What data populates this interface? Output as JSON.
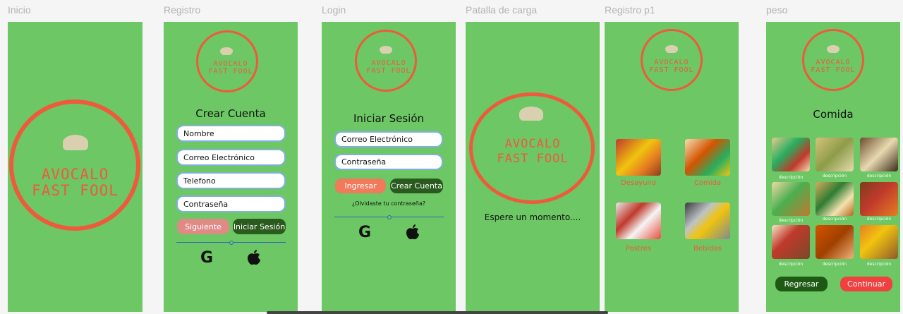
{
  "colors": {
    "frame_bg": "#6cc764",
    "logo": "#ef5a3c",
    "input_border": "#7fb0e0",
    "dark_button": "#2a5a1e",
    "salmon_button": "#e08a86",
    "orange_button": "#f07a5a",
    "red_button": "#f04040"
  },
  "frames": {
    "inicio": {
      "label": "Inicio",
      "logo_line1": "AVOCALO",
      "logo_line2": "FAST FOOL"
    },
    "registro": {
      "label": "Registro",
      "logo_line1": "AVOCALO",
      "logo_line2": "FAST FOOL",
      "title": "Crear Cuenta",
      "fields": [
        "Nombre",
        "Correo Electrónico",
        "Telefono",
        "Contraseña"
      ],
      "next_label": "Siguiente",
      "login_label": "Iniciar Sesión",
      "google_glyph": "G",
      "apple_glyph": ""
    },
    "login": {
      "label": "Login",
      "logo_line1": "AVOCALO",
      "logo_line2": "FAST FOOL",
      "title": "Iniciar Sesión",
      "fields": [
        "Correo Electrónico",
        "Contraseña"
      ],
      "enter_label": "Ingresar",
      "create_label": "Crear Cuenta",
      "forgot": "¿Olvidaste tu contraseña?",
      "google_glyph": "G"
    },
    "carga": {
      "label": "Patalla de carga",
      "logo_line1": "AVOCALO",
      "logo_line2": "FAST FOOL",
      "message": "Espere un momento...."
    },
    "registro_p1": {
      "label": "Registro p1",
      "logo_line1": "AVOCALO",
      "logo_line2": "FAST FOOL",
      "categories": [
        "Desayuno",
        "Comida",
        "Postres",
        "Bebidas"
      ]
    },
    "peso": {
      "label": "peso",
      "logo_line1": "AVOCALO",
      "logo_line2": "FAST FOOL",
      "title": "Comida",
      "item_caption": "descripción",
      "back_label": "Regresar",
      "continue_label": "Continuar"
    }
  }
}
